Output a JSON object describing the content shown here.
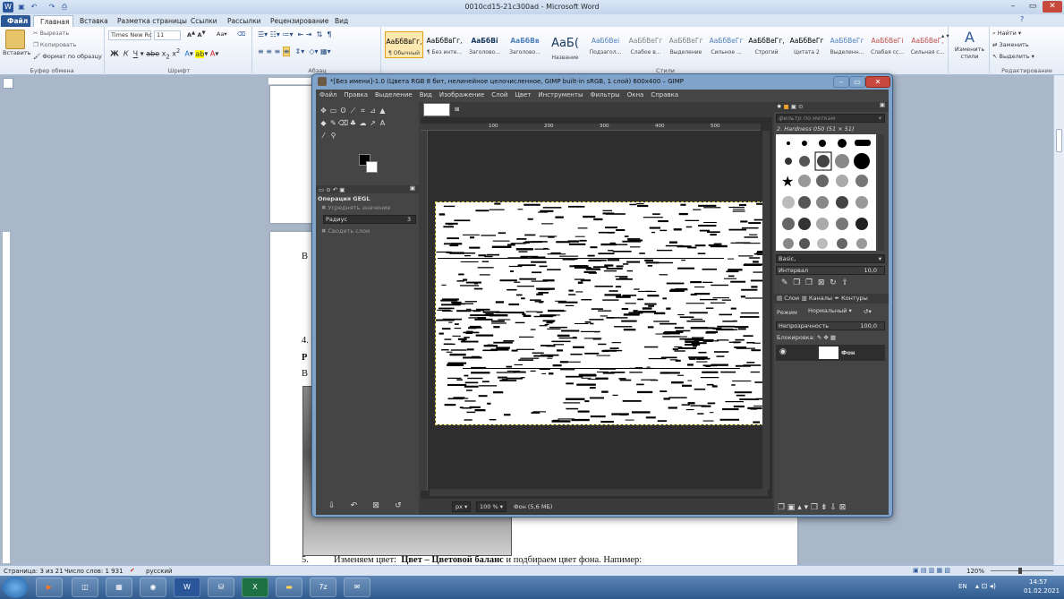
{
  "word": {
    "title": "0010cd15-21c300ad - Microsoft Word",
    "tabs": [
      "Файл",
      "Главная",
      "Вставка",
      "Разметка страницы",
      "Ссылки",
      "Рассылки",
      "Рецензирование",
      "Вид"
    ],
    "clipboard": {
      "paste": "Вставить",
      "cut": "Вырезать",
      "copy": "Копировать",
      "format_painter": "Формат по образцу",
      "group": "Буфер обмена"
    },
    "font": {
      "name": "Times New Rc",
      "size": "11",
      "group": "Шрифт"
    },
    "paragraph_group": "Абзац",
    "styles": [
      {
        "sample": "АаБбВвГг,",
        "name": "¶ Обычный"
      },
      {
        "sample": "АаБбВвГг,",
        "name": "¶ Без инте..."
      },
      {
        "sample": "АаБбВі",
        "name": "Заголово..."
      },
      {
        "sample": "АаБбВв",
        "name": "Заголово..."
      },
      {
        "sample": "АаБ(",
        "name": "Название"
      },
      {
        "sample": "АаБбВеі",
        "name": "Подзагол..."
      },
      {
        "sample": "АаБбВеГг",
        "name": "Слабое в..."
      },
      {
        "sample": "АаБбВеГг",
        "name": "Выделение"
      },
      {
        "sample": "АаБбВеГг",
        "name": "Сильное ..."
      },
      {
        "sample": "АаБбВеГг,",
        "name": "Строгий"
      },
      {
        "sample": "АаБбВеГг",
        "name": "Цитата 2"
      },
      {
        "sample": "АаБбВеГг",
        "name": "Выделенн..."
      },
      {
        "sample": "АаБбВеГі",
        "name": "Слабая сс..."
      },
      {
        "sample": "АаБбВеГ,",
        "name": "Сильная с..."
      }
    ],
    "styles_group": "Стили",
    "change_styles": "Изменить стили",
    "editing": {
      "find": "Найти",
      "replace": "Заменить",
      "select": "Выделить",
      "group": "Редактирование"
    },
    "doc": {
      "b1": "В",
      "l4": "4.",
      "lp": "Р",
      "lb": "В",
      "step5_num": "5.",
      "step5_pre": "Изменяем цвет:",
      "step5_bold": "Цвет – Цветовой баланс",
      "step5_post": "и подбираем цвет фона. Напимер:"
    },
    "status": {
      "page": "Страница: 3 из 21",
      "words": "Число слов: 1 931",
      "lang": "русский",
      "zoom": "120%"
    }
  },
  "gimp": {
    "title": "*[Без имени]-1.0 (Цвета RGB 8 бит, нелинейное целочисленное, GIMP built-in sRGB, 1 слой) 600x400 – GIMP",
    "menu": [
      "Файл",
      "Правка",
      "Выделение",
      "Вид",
      "Изображение",
      "Слой",
      "Цвет",
      "Инструменты",
      "Фильтры",
      "Окна",
      "Справка"
    ],
    "gegl": {
      "title": "Операция GEGL",
      "avg": "Усреднять значение",
      "radius_label": "Радиус",
      "radius_value": "3",
      "merge": "Сводить слои"
    },
    "ruler": [
      "100",
      "200",
      "300",
      "400",
      "500"
    ],
    "status": {
      "unit": "px",
      "zoom": "100 %",
      "layer": "Фон (5,6 МБ)"
    },
    "brushes": {
      "filter_placeholder": "фильтр по меткам",
      "current": "2. Hardness 050 (51 × 51)",
      "set": "Basic,",
      "interval_label": "Интервал",
      "interval_value": "10,0"
    },
    "layers": {
      "tabs": [
        "Слои",
        "Каналы",
        "Контуры"
      ],
      "mode_label": "Режим",
      "mode_value": "Нормальный",
      "opacity_label": "Непрозрачность",
      "opacity_value": "100,0",
      "lock_label": "Блокировка:",
      "layer_name": "Фон"
    }
  },
  "taskbar": {
    "lang": "EN",
    "time": "14:57",
    "date": "01.02.2021"
  }
}
